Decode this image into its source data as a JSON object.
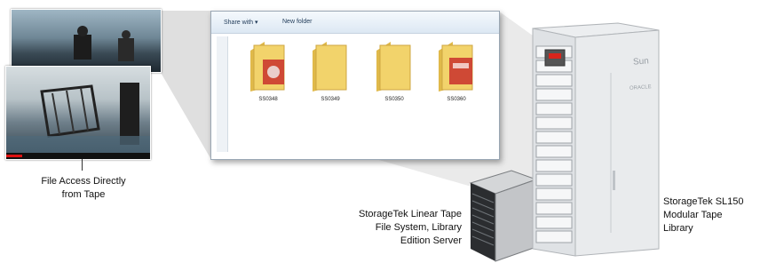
{
  "explorer": {
    "toolbar": {
      "share_with": "Share with",
      "new_folder": "New folder"
    },
    "folders": [
      "SS0348",
      "SS0349",
      "SS0350",
      "SS0360"
    ]
  },
  "labels": {
    "file_access": [
      "File Access Directly",
      "from Tape"
    ],
    "ltfs_server": [
      "StorageTek Linear Tape",
      "File System, Library",
      "Edition Server"
    ],
    "sl150": [
      "StorageTek SL150",
      "Modular Tape",
      "Library"
    ]
  },
  "library_branding": {
    "sun": "Sun",
    "oracle": "ORACLE"
  },
  "colors": {
    "folder": "#f2d36b",
    "oracle_red": "#d9251c",
    "library_body": "#e4e6e8"
  }
}
